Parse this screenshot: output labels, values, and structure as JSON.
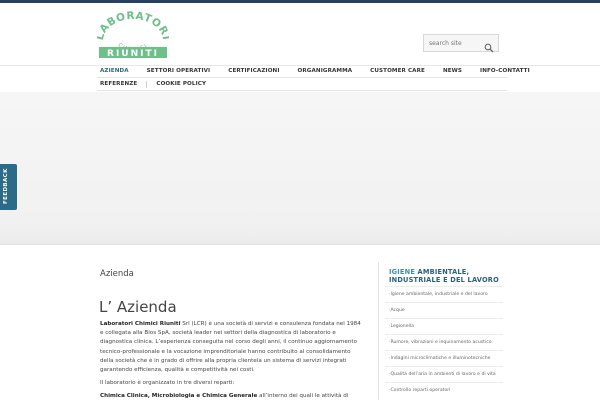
{
  "colors": {
    "topbar": "#25415f",
    "logo_green": "#6fbf8b",
    "accent": "#2c6b88",
    "nav_active": "#2b6a83"
  },
  "logo": {
    "top_text": "LABORATORI",
    "middle_text": "CHIMICI",
    "bottom_text": "RIUNITI"
  },
  "search": {
    "placeholder": "search site",
    "icon": "search-icon"
  },
  "nav": {
    "row1": [
      "AZIENDA",
      "SETTORI OPERATIVI",
      "CERTIFICAZIONI",
      "ORGANIGRAMMA",
      "CUSTOMER CARE",
      "NEWS",
      "INFO-CONTATTI"
    ],
    "row2": [
      "REFERENZE",
      "COOKIE POLICY"
    ],
    "active": "AZIENDA"
  },
  "feedback": {
    "label": "FEEDBACK"
  },
  "breadcrumb": "Azienda",
  "page_title": "L’ Azienda",
  "content": {
    "p1_bold": "Laboratori Chimici Riuniti",
    "p1_rest": " Srl (LCR) è una società di servizi e consulenza fondata nel 1984 e collegata alla Bios SpA, società leader nei settori della diagnostica di laboratorio e diagnostica clinica. L’esperienza conseguita nel corso degli anni, il continuo aggiornamento tecnico-professionale e la vocazione imprenditoriale hanno contribuito al consolidamento della società che è in grado di offrire alla propria clientela un sistema di servizi integrati garantendo efficienza, qualità e competitività nei costi.",
    "p2": "Il laboratorio è organizzato in tre diversi reparti:",
    "p3_bold": "Chimica Clinica, Microbiologia e Chimica Generale",
    "p3_rest": " all’interno dei quali le attività di"
  },
  "sidebar": {
    "title_highlight": "IGIENE",
    "title_rest": " AMBIENTALE, INDUSTRIALE E DEL LAVORO",
    "items": [
      "Igiene ambientale, industriale e del lavoro",
      "Acque",
      "Legionella",
      "Rumore, vibrazioni e inquinamento acustico",
      "Indagini microclimatiche e illuminotecniche",
      "Qualità dell’aria in ambienti di lavoro e di vita",
      "Controllo reparti operatori"
    ]
  }
}
